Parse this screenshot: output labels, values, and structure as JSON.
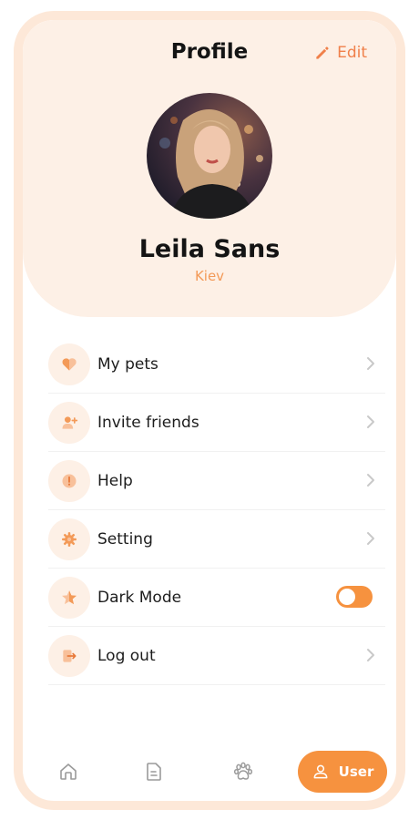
{
  "header": {
    "title": "Profile",
    "edit_label": "Edit"
  },
  "profile": {
    "name": "Leila Sans",
    "city": "Kiev"
  },
  "menu": {
    "items": [
      {
        "label": "My pets",
        "icon": "heart-icon"
      },
      {
        "label": "Invite friends",
        "icon": "add-user-icon"
      },
      {
        "label": "Help",
        "icon": "info-icon"
      },
      {
        "label": "Setting",
        "icon": "gear-icon"
      },
      {
        "label": "Dark Mode",
        "icon": "star-icon"
      },
      {
        "label": "Log out",
        "icon": "logout-icon"
      }
    ],
    "dark_mode_enabled": false
  },
  "nav": {
    "items": [
      "home-icon",
      "document-icon",
      "paw-icon"
    ],
    "active_label": "User"
  },
  "colors": {
    "accent": "#f6923f",
    "header_bg": "#fdf0e6",
    "frame": "#fde8d8"
  }
}
